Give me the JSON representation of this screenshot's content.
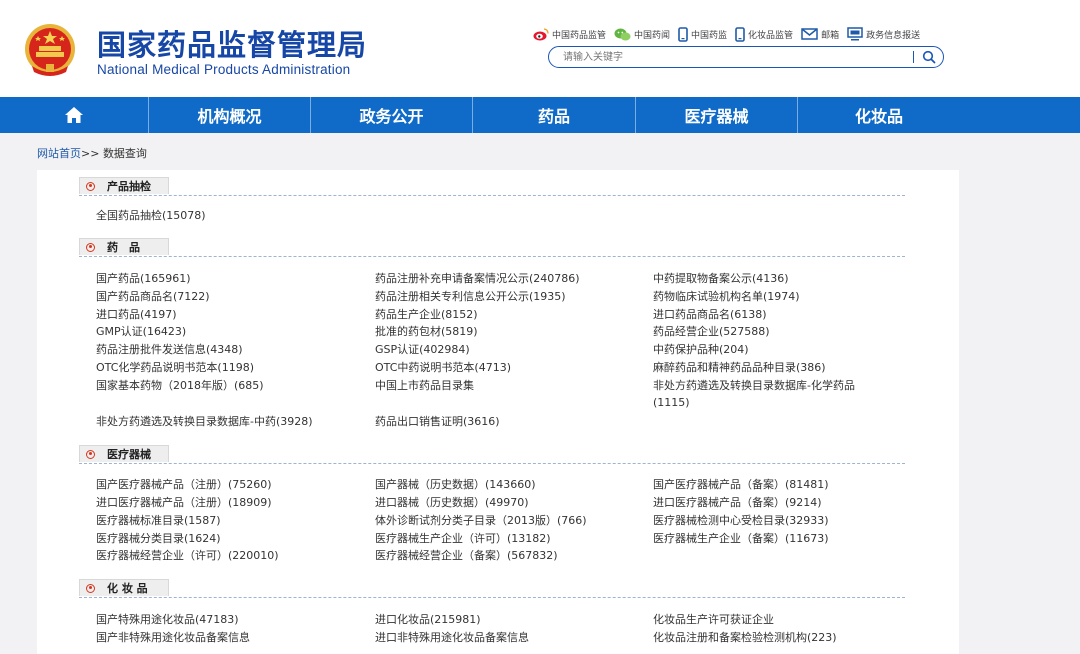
{
  "header": {
    "title_cn": "国家药品监督管理局",
    "title_en": "National Medical Products Administration",
    "top_links": [
      {
        "label": "中国药品监管",
        "icon": "weibo-icon"
      },
      {
        "label": "中国药闻",
        "icon": "wechat-icon"
      },
      {
        "label": "中国药监",
        "icon": "mobile-icon"
      },
      {
        "label": "化妆品监管",
        "icon": "mobile-icon"
      },
      {
        "label": "邮箱",
        "icon": "mail-icon"
      },
      {
        "label": "政务信息报送",
        "icon": "monitor-icon"
      }
    ],
    "search": {
      "placeholder": "请输入关键字",
      "button_icon": "search-icon"
    }
  },
  "nav": {
    "home_icon": "home-icon",
    "items": [
      "机构概况",
      "政务公开",
      "药品",
      "医疗器械",
      "化妆品"
    ]
  },
  "breadcrumb": {
    "home": "网站首页",
    "separator": ">>",
    "current": "数据查询"
  },
  "sections": [
    {
      "title": "产品抽检",
      "items": [
        "全国药品抽检(15078)"
      ]
    },
    {
      "title": "药　品",
      "items": [
        "国产药品(165961)",
        "药品注册补充申请备案情况公示(240786)",
        "中药提取物备案公示(4136)",
        "国产药品商品名(7122)",
        "药品注册相关专利信息公开公示(1935)",
        "药物临床试验机构名单(1974)",
        "进口药品(4197)",
        "药品生产企业(8152)",
        "进口药品商品名(6138)",
        "GMP认证(16423)",
        "批准的药包材(5819)",
        "药品经营企业(527588)",
        "药品注册批件发送信息(4348)",
        "GSP认证(402984)",
        "中药保护品种(204)",
        "OTC化学药品说明书范本(1198)",
        "OTC中药说明书范本(4713)",
        "麻醉药品和精神药品品种目录(386)",
        "国家基本药物（2018年版）(685)",
        "中国上市药品目录集",
        "非处方药遴选及转换目录数据库-化学药品(1115)",
        "非处方药遴选及转换目录数据库-中药(3928)",
        "药品出口销售证明(3616)"
      ]
    },
    {
      "title": "医疗器械",
      "items": [
        "国产医疗器械产品（注册）(75260)",
        "国产器械（历史数据）(143660)",
        "国产医疗器械产品（备案）(81481)",
        "进口医疗器械产品（注册）(18909)",
        "进口器械（历史数据）(49970)",
        "进口医疗器械产品（备案）(9214)",
        "医疗器械标准目录(1587)",
        "体外诊断试剂分类子目录（2013版）(766)",
        "医疗器械检测中心受检目录(32933)",
        "医疗器械分类目录(1624)",
        "医疗器械生产企业（许可）(13182)",
        "医疗器械生产企业（备案）(11673)",
        "医疗器械经营企业（许可）(220010)",
        "医疗器械经营企业（备案）(567832)"
      ]
    },
    {
      "title": "化 妆 品",
      "items": [
        "国产特殊用途化妆品(47183)",
        "进口化妆品(215981)",
        "化妆品生产许可获证企业",
        "国产非特殊用途化妆品备案信息",
        "进口非特殊用途化妆品备案信息",
        "化妆品注册和备案检验检测机构(223)"
      ]
    }
  ],
  "colors": {
    "brand_blue": "#1747a6",
    "nav_bg": "#0f6ac8",
    "accent_red": "#d9351c"
  }
}
